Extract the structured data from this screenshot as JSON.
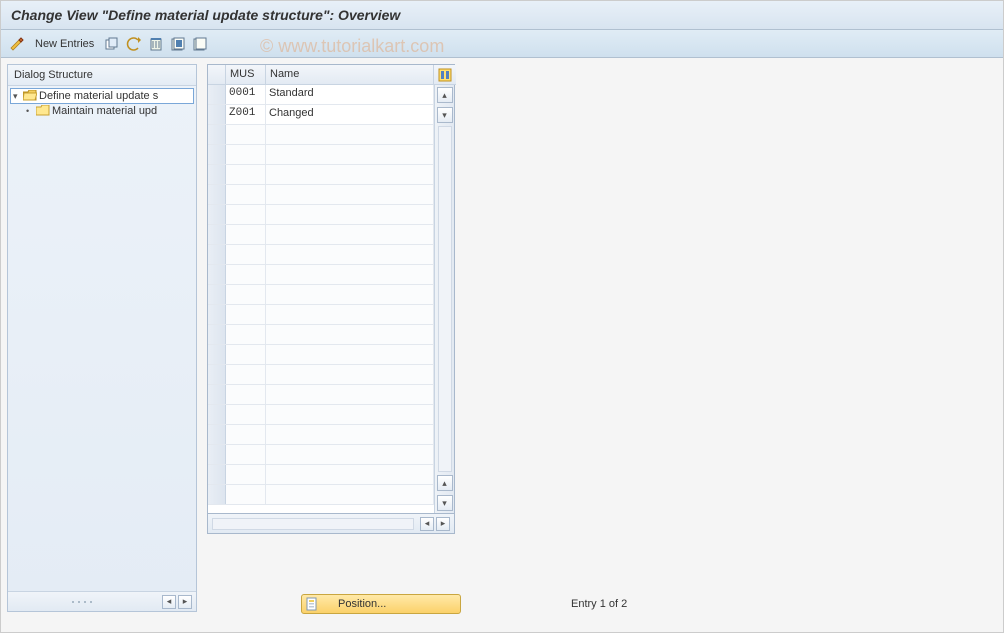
{
  "title": "Change View \"Define material update structure\": Overview",
  "toolbar": {
    "new_entries_label": "New Entries"
  },
  "watermark": "© www.tutorialkart.com",
  "sidebar": {
    "header": "Dialog Structure",
    "items": [
      {
        "label": "Define material update s",
        "selected": true,
        "open": true,
        "level": 0
      },
      {
        "label": "Maintain material upd",
        "selected": false,
        "open": false,
        "level": 1
      }
    ]
  },
  "table": {
    "columns": {
      "mus": "MUS",
      "name": "Name"
    },
    "rows": [
      {
        "mus": "0001",
        "name": "Standard"
      },
      {
        "mus": "Z001",
        "name": "Changed"
      }
    ],
    "empty_rows": 19
  },
  "footer": {
    "position_label": "Position...",
    "entry_text": "Entry 1 of 2"
  }
}
